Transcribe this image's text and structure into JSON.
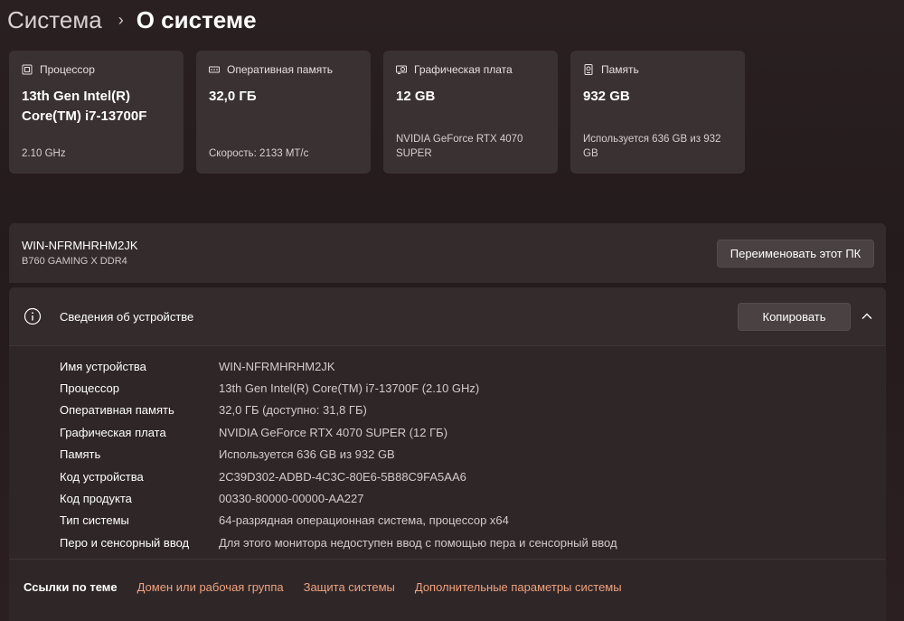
{
  "breadcrumb": {
    "parent": "Система",
    "separator": "›",
    "current": "О системе"
  },
  "cards": [
    {
      "icon": "cpu-icon",
      "label": "Процессор",
      "value": "13th Gen Intel(R) Core(TM) i7-13700F",
      "sub": "2.10 GHz"
    },
    {
      "icon": "ram-icon",
      "label": "Оперативная память",
      "value": "32,0 ГБ",
      "sub": "Скорость: 2133 МТ/с"
    },
    {
      "icon": "gpu-icon",
      "label": "Графическая плата",
      "value": "12 GB",
      "sub": "NVIDIA GeForce RTX 4070 SUPER"
    },
    {
      "icon": "storage-icon",
      "label": "Память",
      "value": "932 GB",
      "sub": "Используется 636 GB из 932 GB"
    }
  ],
  "pc": {
    "name": "WIN-NFRMHRHM2JK",
    "model": "B760 GAMING X DDR4",
    "rename_label": "Переименовать этот ПК"
  },
  "device_info": {
    "title": "Сведения об устройстве",
    "copy_label": "Копировать",
    "rows": [
      {
        "label": "Имя устройства",
        "value": "WIN-NFRMHRHM2JK"
      },
      {
        "label": "Процессор",
        "value": "13th Gen Intel(R) Core(TM) i7-13700F (2.10 GHz)"
      },
      {
        "label": "Оперативная память",
        "value": "32,0 ГБ (доступно: 31,8 ГБ)"
      },
      {
        "label": "Графическая плата",
        "value": "NVIDIA GeForce RTX 4070 SUPER (12 ГБ)"
      },
      {
        "label": "Память",
        "value": "Используется 636 GB из 932 GB"
      },
      {
        "label": "Код устройства",
        "value": "2C39D302-ADBD-4C3C-80E6-5B88C9FA5AA6"
      },
      {
        "label": "Код продукта",
        "value": "00330-80000-00000-AA227"
      },
      {
        "label": "Тип системы",
        "value": "64-разрядная операционная система, процессор x64"
      },
      {
        "label": "Перо и сенсорный ввод",
        "value": "Для этого монитора недоступен ввод с помощью пера и сенсорный ввод"
      }
    ]
  },
  "related_links": {
    "title": "Ссылки по теме",
    "links": [
      "Домен или рабочая группа",
      "Защита системы",
      "Дополнительные параметры системы"
    ]
  },
  "colors": {
    "accent_link": "#f0a37f",
    "card_bg": "#3a3133",
    "panel_bg": "#342b2d"
  }
}
